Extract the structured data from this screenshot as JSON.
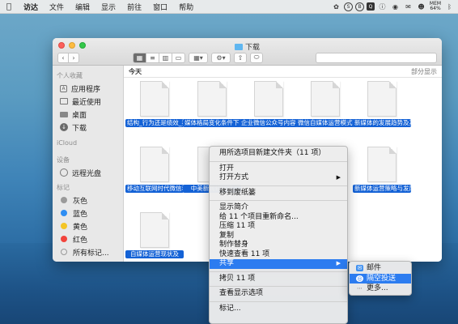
{
  "menubar": {
    "apple": "",
    "items": [
      "访达",
      "文件",
      "编辑",
      "显示",
      "前往",
      "窗口",
      "帮助"
    ],
    "status": {
      "mem_label": "MEM",
      "mem_value": "64%"
    }
  },
  "window": {
    "title": "下载",
    "sidebar": {
      "favorites_header": "个人收藏",
      "favorites": [
        {
          "label": "应用程序",
          "icon": "apps-icon"
        },
        {
          "label": "最近使用",
          "icon": "recents-icon"
        },
        {
          "label": "桌面",
          "icon": "desktop-icon"
        },
        {
          "label": "下载",
          "icon": "downloads-icon"
        }
      ],
      "icloud_header": "iCloud",
      "devices_header": "设备",
      "devices": [
        {
          "label": "远程光盘",
          "icon": "disc-icon"
        }
      ],
      "tags_header": "标记",
      "tags": [
        {
          "label": "灰色",
          "color": "#9a9a9a"
        },
        {
          "label": "蓝色",
          "color": "#2f8ef3"
        },
        {
          "label": "黄色",
          "color": "#f4c526"
        },
        {
          "label": "红色",
          "color": "#f2443c"
        },
        {
          "label": "所有标记...",
          "color": ""
        }
      ]
    },
    "content": {
      "section": "今天",
      "show_all": "部分显示",
      "files": [
        {
          "name": "结构_行为还是绩效_我国...李倩.caj"
        },
        {
          "name": "媒体格局变化条件下思想...陈旻.caj"
        },
        {
          "name": "企业微信公众号内容传播...沁竹.caj"
        },
        {
          "name": "微信自媒体运营模式研究_张莉芳.caj"
        },
        {
          "name": "新媒体的发展趋势及其对..._汪巍.caj"
        },
        {
          "name": "移动互联网时代微信着重直...姣姣.caj"
        },
        {
          "name": "中美新闻较研究"
        },
        {
          "name": "新媒体运营策略与发展趋...恩雨.caj"
        },
        {
          "name": "自媒体运营现状及"
        }
      ]
    }
  },
  "context_menu": {
    "items": [
      "用所选项目新建文件夹（11 项）",
      "打开",
      "打开方式",
      "移到废纸篓",
      "显示简介",
      "给 11 个项目重新命名...",
      "压缩 11 项",
      "复制",
      "制作替身",
      "快速查看 11 项",
      "共享",
      "拷贝 11 项",
      "查看显示选项",
      "标记..."
    ]
  },
  "share_submenu": {
    "items": [
      "邮件",
      "隔空投送",
      "更多..."
    ]
  }
}
